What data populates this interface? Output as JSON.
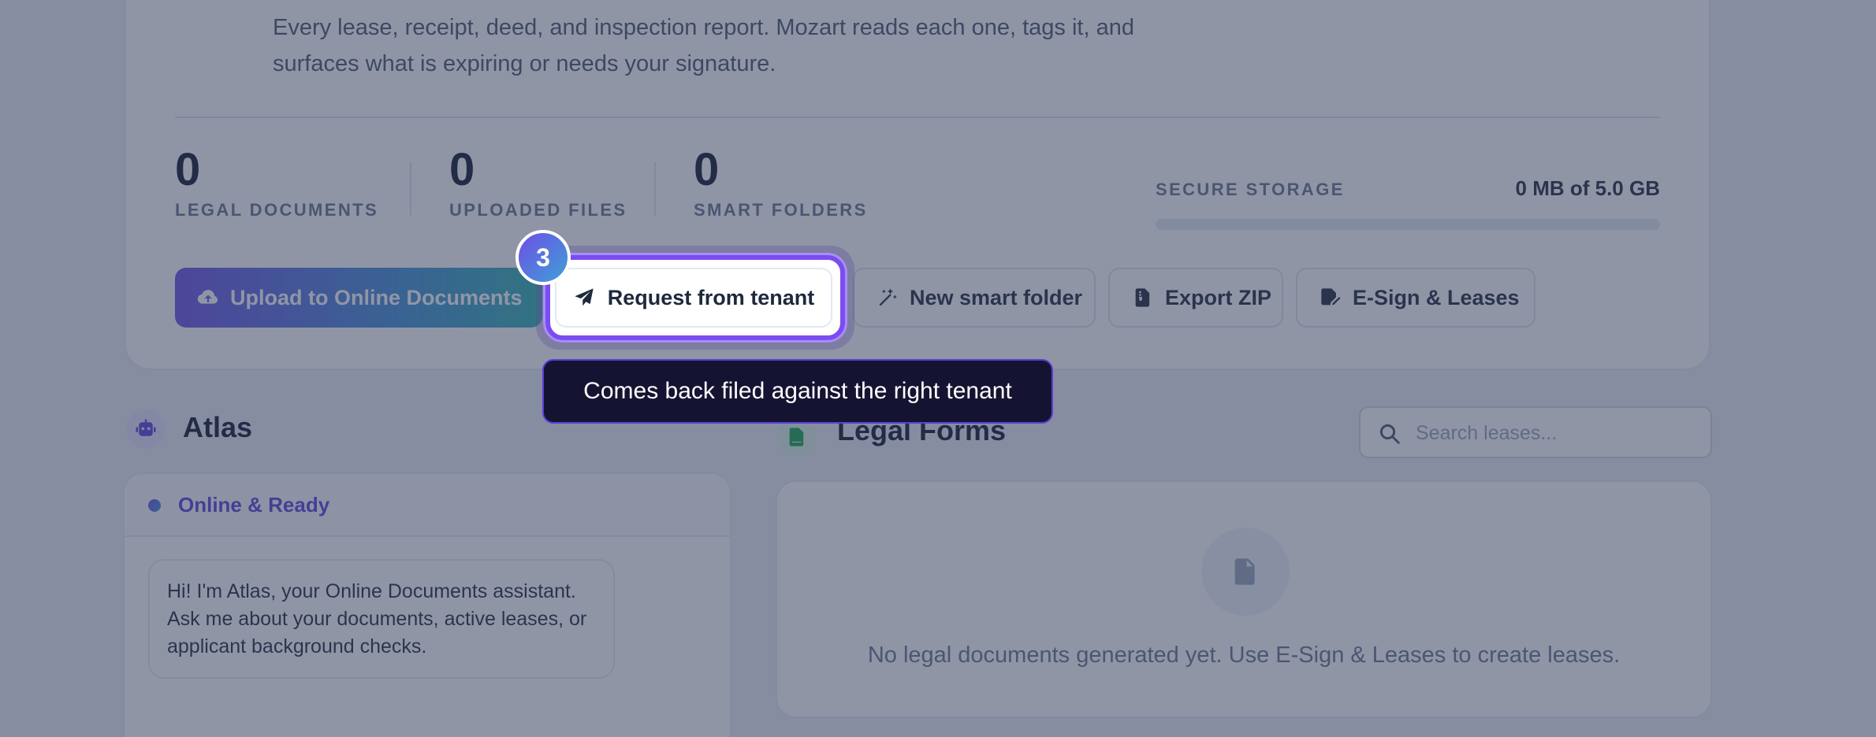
{
  "hero": {
    "description": "Every lease, receipt, deed, and inspection report. Mozart reads each one, tags it, and surfaces what is expiring or needs your signature."
  },
  "stats": [
    {
      "value": "0",
      "label": "LEGAL DOCUMENTS"
    },
    {
      "value": "0",
      "label": "UPLOADED FILES"
    },
    {
      "value": "0",
      "label": "SMART FOLDERS"
    }
  ],
  "storage": {
    "label": "SECURE STORAGE",
    "value": "0 MB of 5.0 GB",
    "used_fraction": 0
  },
  "actions": {
    "upload": "Upload to Online Documents",
    "request": "Request from tenant",
    "smart_folder": "New smart folder",
    "export": "Export ZIP",
    "esign": "E-Sign & Leases"
  },
  "tour": {
    "step": "3",
    "tooltip": "Comes back filed against the right tenant"
  },
  "atlas": {
    "title": "Atlas",
    "status": "Online & Ready",
    "message": "Hi! I'm Atlas, your Online Documents assistant. Ask me about your documents, active leases, or applicant background checks."
  },
  "legal_forms": {
    "title": "Legal Forms",
    "search_placeholder": "Search leases...",
    "empty_text": "No legal documents generated yet. Use E-Sign & Leases to create leases."
  },
  "colors": {
    "accent": "#6d4fe6",
    "accent_secondary": "#3f8fd6",
    "tooltip_bg": "#141432",
    "status_text": "#5b3fd9"
  }
}
